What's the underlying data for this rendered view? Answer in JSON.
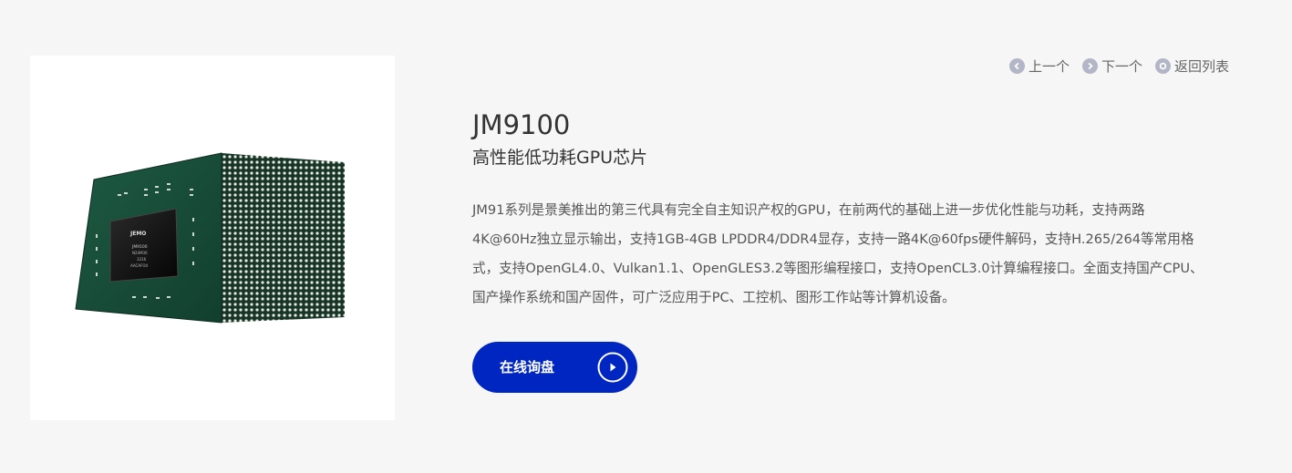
{
  "nav": {
    "prev_label": "上一个",
    "next_label": "下一个",
    "list_label": "返回列表",
    "prev_icon": "chevron-left-icon",
    "next_icon": "chevron-right-icon",
    "list_icon": "circle-dot-icon"
  },
  "product": {
    "name": "JM9100",
    "subtitle": "高性能低功耗GPU芯片",
    "description_lines": [
      "JM91系列是景美推出的第三代具有完全自主知识产权的GPU，在前两代的基础上进一步优化性能与功耗，支持两路",
      "4K@60Hz独立显示输出，支持1GB-4GB LPDDR4/DDR4显存，支持一路4K@60fps硬件解码，支持H.265/264等常用格",
      "式，支持OpenGL4.0、Vulkan1.1、OpenGLES3.2等图形编程接口，支持OpenCL3.0计算编程接口。全面支持国产CPU、",
      "国产操作系统和国产固件，可广泛应用于PC、工控机、图形工作站等计算机设备。"
    ],
    "image_icon": "gpu-chip-image",
    "chip_marking": {
      "brand": "JEMO",
      "model": "JM9100",
      "line3": "N24M36",
      "line4": "3316",
      "line5": "AACAFO4"
    }
  },
  "cta": {
    "label": "在线询盘",
    "icon": "play-circle-icon"
  },
  "colors": {
    "background": "#f6f6f6",
    "accent": "#0026c2",
    "nav_icon": "#b3b6c6",
    "text_primary": "#333333",
    "text_body": "#555555"
  }
}
